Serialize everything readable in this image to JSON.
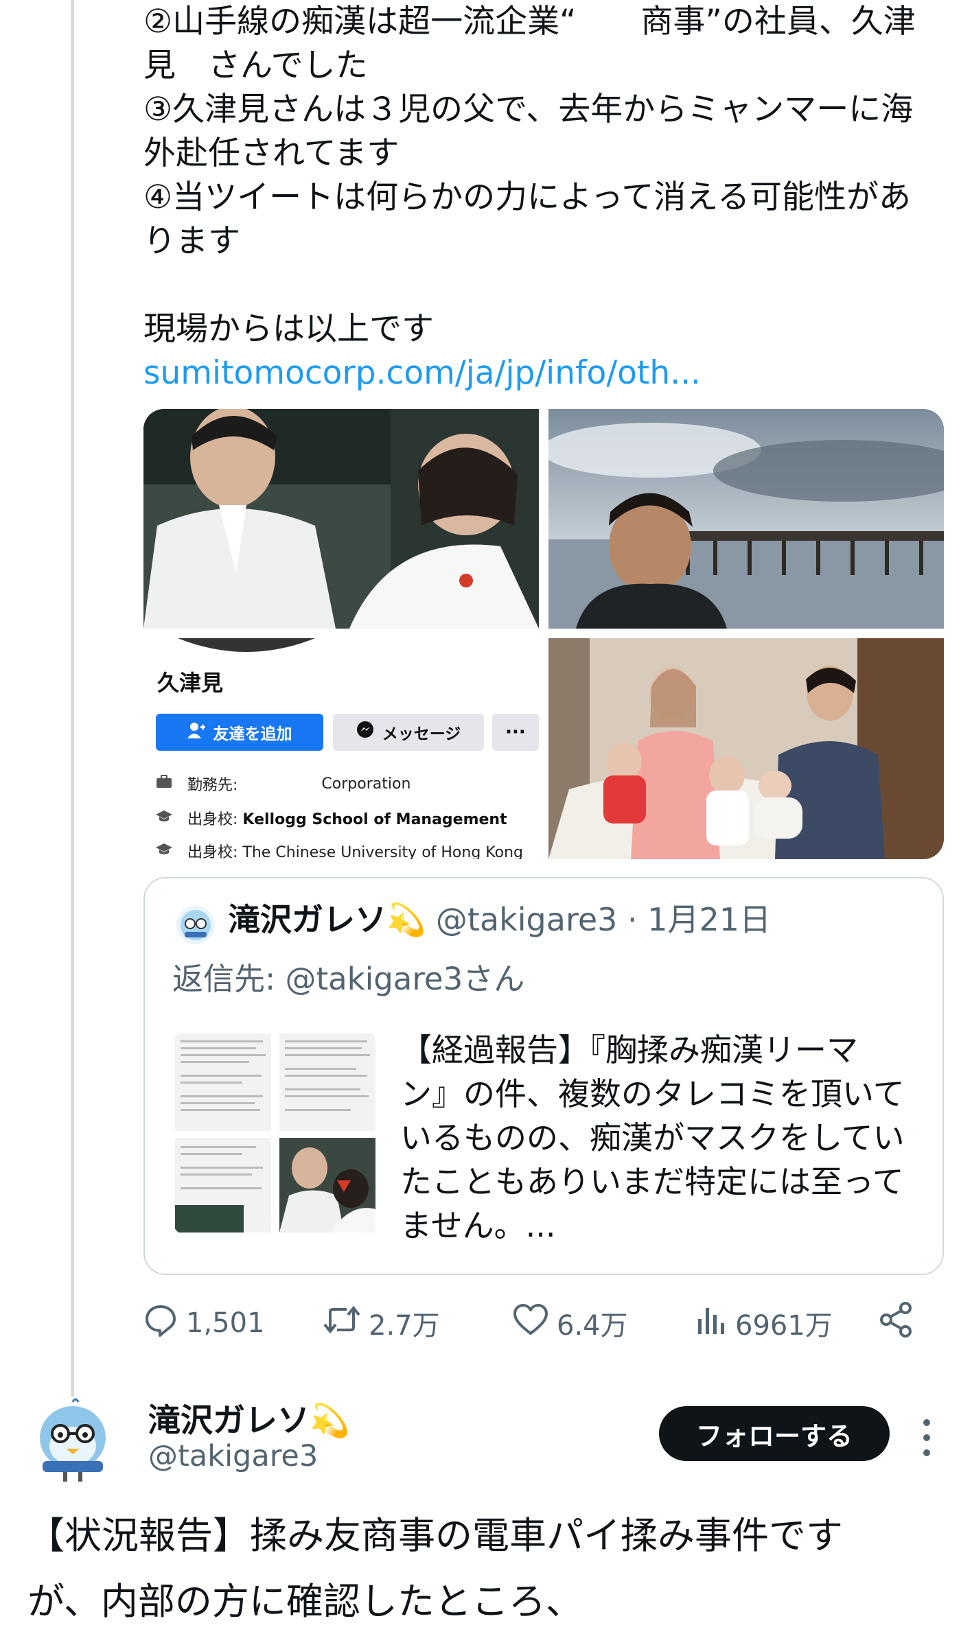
{
  "tweet": {
    "lines": [
      "②山手線の痴漢は超一流企業“　　商事”の社員、久津",
      "見　さんでした",
      "③久津見さんは３児の父で、去年からミャンマーに海",
      "外赴任されてます",
      "④当ツイートは何らかの力によって消える可能性があ",
      "ります",
      "現場からは以上です"
    ],
    "link": "sumitomocorp.com/ja/jp/info/oth..."
  },
  "media": {
    "profile_card": {
      "name": "久津見",
      "add_friend": "友達を追加",
      "message": "メッセージ",
      "more": "···",
      "work_label": "勤務先:",
      "work_value": "Corporation",
      "edu1_label": "出身校:",
      "edu1_value": "Kellogg School of Management",
      "edu2_label": "出身校:",
      "edu2_value": "The Chinese University of Hong Kong"
    }
  },
  "quote": {
    "name": "滝沢ガレソ💫",
    "handle": "@takigare3 · 1月21日",
    "reply_to": "返信先: @takigare3さん",
    "text_lines": [
      "【経過報告】『胸揉み痴漢リーマ",
      "ン』の件、複数のタレコミを頂いて",
      "いるものの、痴漢がマスクをしてい",
      "たこともありいまだ特定には至って",
      "ません。..."
    ]
  },
  "actions": {
    "replies": "1,501",
    "retweets": "2.7万",
    "likes": "6.4万",
    "views": "6961万"
  },
  "author": {
    "name": "滝沢ガレソ💫",
    "handle": "@takigare3",
    "follow": "フォローする"
  },
  "next_tweet": {
    "lines": [
      "【状況報告】揉み友商事の電車パイ揉み事件です",
      "が、内部の方に確認したところ、"
    ]
  },
  "colors": {
    "link": "#1d9bf0",
    "muted": "#536471",
    "text": "#0f1419",
    "fb_blue": "#1877f2"
  }
}
